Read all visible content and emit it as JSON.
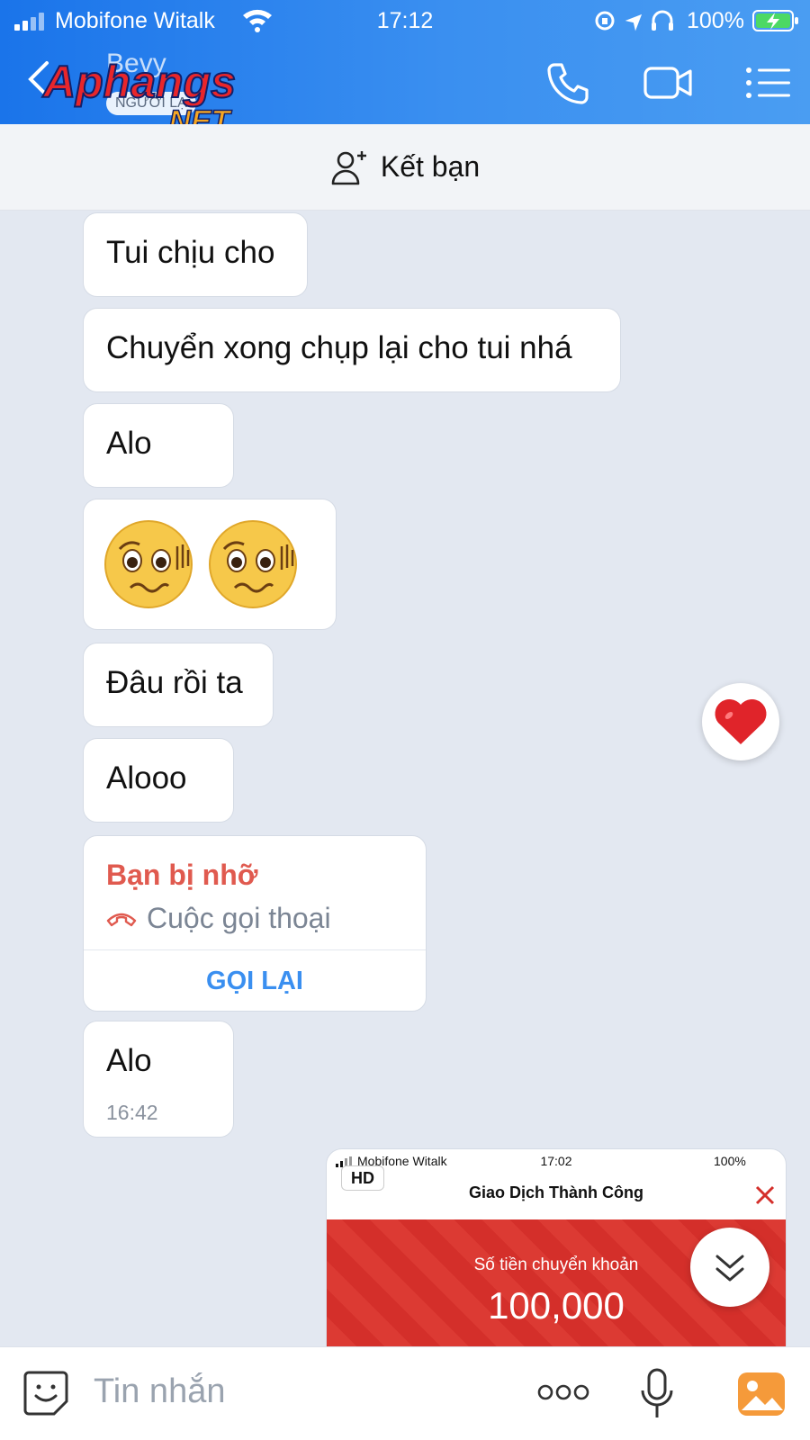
{
  "status": {
    "carrier": "Mobifone Witalk",
    "time": "17:12",
    "battery": "100%"
  },
  "header": {
    "contact_name": "Bevy",
    "stranger_badge": "NGƯỜI LẠ",
    "watermark": "Aphangs.NET",
    "icons": [
      "back-arrow-icon",
      "phone-icon",
      "video-camera-icon",
      "menu-list-icon"
    ]
  },
  "friend_bar": {
    "label": "Kết bạn",
    "icon": "add-friend-icon"
  },
  "messages": [
    {
      "text": "Tui chịu cho"
    },
    {
      "text": "Chuyển xong chụp lại cho tui nhá"
    },
    {
      "text": "Alo"
    },
    {
      "emoji": [
        "worried-face-emoji",
        "worried-face-emoji"
      ]
    },
    {
      "text": "Đâu rồi ta"
    },
    {
      "text": "Alooo"
    },
    {
      "missed_call": {
        "title": "Bạn bị nhỡ",
        "subtitle": "Cuộc gọi thoại",
        "action": "GỌI LẠI"
      }
    },
    {
      "text": "Alo",
      "time": "16:42"
    }
  ],
  "reaction_button": {
    "icon": "heart-icon"
  },
  "image_preview": {
    "badge": "HD",
    "status_carrier": "Mobifone Witalk",
    "status_time": "17:02",
    "status_battery": "100%",
    "title": "Giao Dịch Thành Công",
    "amount_label": "Số tiền chuyển khoản",
    "amount": "100,000"
  },
  "scroll_button": {
    "icon": "double-chevron-down-icon"
  },
  "input": {
    "placeholder": "Tin nhắn",
    "icons": [
      "sticker-icon",
      "more-icon",
      "microphone-icon",
      "gallery-icon"
    ]
  },
  "colors": {
    "header_blue": "#1a74ea",
    "chat_bg": "#e3e8f1",
    "missed_red": "#e05a4f",
    "action_blue": "#3a8ff0"
  }
}
